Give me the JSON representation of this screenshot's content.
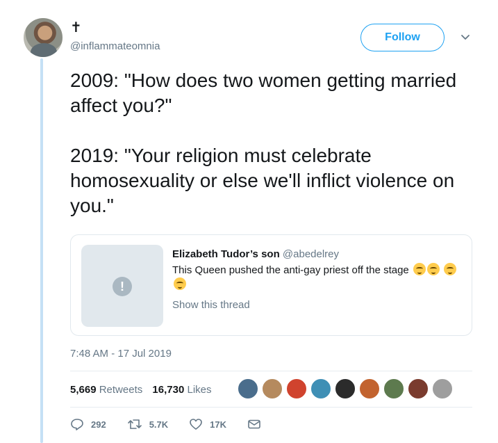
{
  "tweet": {
    "display_name": "✝",
    "handle": "@inflammateomnia",
    "follow_label": "Follow",
    "text": "2009: \"How does two women getting married affect you?\"\n\n2019: \"Your religion must celebrate homosexuality or else we'll inflict violence on you.\"",
    "timestamp": "7:48 AM - 17 Jul 2019"
  },
  "quote": {
    "author_name": "Elizabeth Tudor’s son",
    "author_handle": "@abedelrey",
    "text": "This Queen pushed the anti-gay priest off the stage",
    "show_thread": "Show this thread",
    "thumbnail_icon": "alert-icon"
  },
  "stats": {
    "retweets_count": "5,669",
    "retweets_label": "Retweets",
    "likes_count": "16,730",
    "likes_label": "Likes",
    "liker_avatars": 9
  },
  "actions": {
    "reply_count": "292",
    "retweet_count": "5.7K",
    "like_count": "17K"
  },
  "colors": {
    "accent": "#1da1f2",
    "thread_line": "#c4e0f5",
    "muted_text": "#657786"
  }
}
